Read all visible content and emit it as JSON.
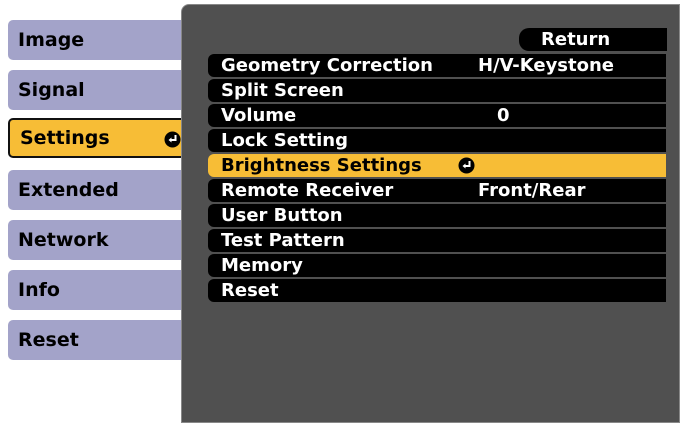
{
  "tabs": [
    {
      "label": "Image",
      "active": false
    },
    {
      "label": "Signal",
      "active": false
    },
    {
      "label": "Settings",
      "active": true
    },
    {
      "label": "Extended",
      "active": false
    },
    {
      "label": "Network",
      "active": false
    },
    {
      "label": "Info",
      "active": false
    },
    {
      "label": "Reset",
      "active": false
    }
  ],
  "return_label": "Return",
  "menu": [
    {
      "label": "Geometry Correction",
      "value": "H/V-Keystone"
    },
    {
      "label": "Split Screen",
      "value": ""
    },
    {
      "label": "Volume",
      "value": "0"
    },
    {
      "label": "Lock Setting",
      "value": ""
    },
    {
      "label": "Brightness Settings",
      "value": "",
      "selected": true
    },
    {
      "label": "Remote Receiver",
      "value": "Front/Rear"
    },
    {
      "label": "User Button",
      "value": ""
    },
    {
      "label": "Test Pattern",
      "value": ""
    },
    {
      "label": "Memory",
      "value": ""
    },
    {
      "label": "Reset",
      "value": ""
    }
  ],
  "colors": {
    "highlight": "#f7bd36",
    "tab": "#a3a3c9",
    "panel": "#505050"
  },
  "icons": {
    "enter": "enter-arrow-icon"
  }
}
